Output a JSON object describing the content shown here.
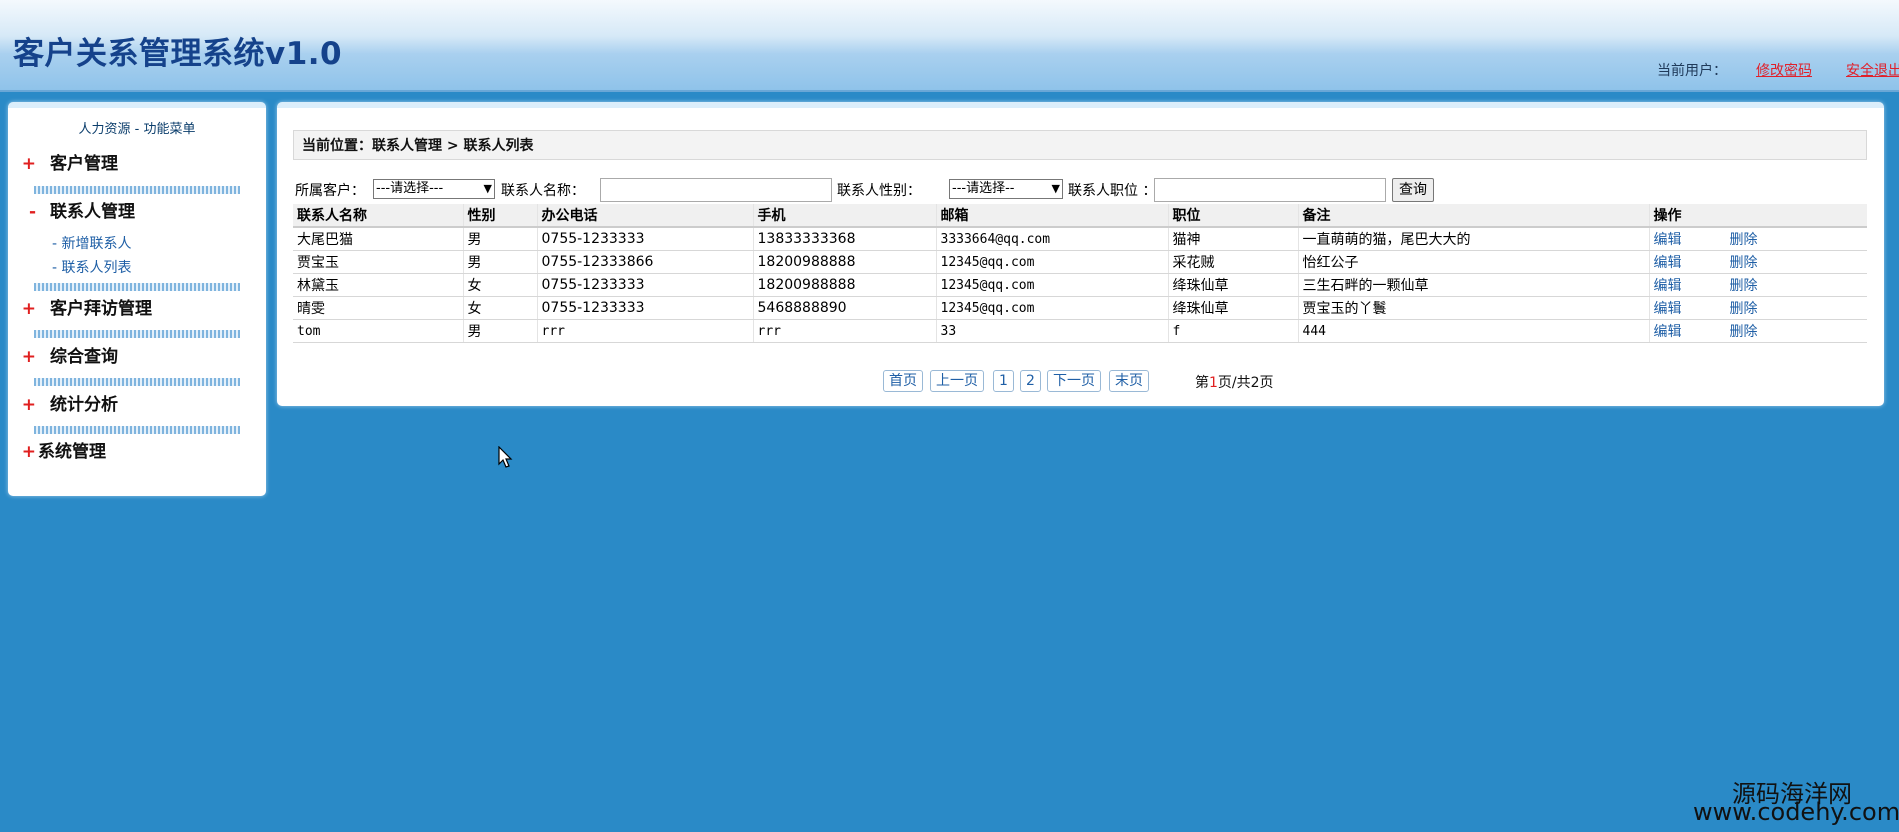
{
  "header": {
    "title": "客户关系管理系统v1.0",
    "current_user_label": "当前用户：",
    "change_password": "修改密码",
    "logout": "安全退出"
  },
  "sidebar": {
    "title": "人力资源 - 功能菜单",
    "groups": [
      {
        "sign": "+",
        "label": "客户管理"
      },
      {
        "sign": "-",
        "label": "联系人管理",
        "items": [
          "-  新增联系人",
          "- 联系人列表"
        ]
      },
      {
        "sign": "+",
        "label": "客户拜访管理"
      },
      {
        "sign": "+",
        "label": "综合查询"
      },
      {
        "sign": "+",
        "label": "统计分析"
      },
      {
        "sign": "+",
        "label": "系统管理"
      }
    ]
  },
  "main": {
    "breadcrumb": "当前位置：联系人管理 > 联系人列表",
    "filters": {
      "customer_label": "所属客户：",
      "customer_select": "---请选择---",
      "name_label": "联系人名称：",
      "gender_label": "联系人性别：",
      "gender_select": "---请选择--",
      "position_label": "联系人职位 ：",
      "query_button": "查询"
    },
    "table": {
      "headers": [
        "联系人名称",
        "性别",
        "办公电话",
        "手机",
        "邮箱",
        "职位",
        "备注",
        "操作"
      ],
      "rows": [
        [
          "大尾巴猫",
          "男",
          "0755-1233333",
          "13833333368",
          "3333664@qq.com",
          "猫神",
          "一直萌萌的猫，尾巴大大的"
        ],
        [
          "贾宝玉",
          "男",
          "0755-12333866",
          "18200988888",
          "12345@qq.com",
          "采花贼",
          "怡红公子"
        ],
        [
          "林黛玉",
          "女",
          "0755-1233333",
          "18200988888",
          "12345@qq.com",
          "绛珠仙草",
          "三生石畔的一颗仙草"
        ],
        [
          "晴雯",
          "女",
          "0755-1233333",
          "5468888890",
          "12345@qq.com",
          "绛珠仙草",
          "贾宝玉的丫鬟"
        ],
        [
          "tom",
          "男",
          "rrr",
          "rrr",
          "33",
          "f",
          "444"
        ]
      ],
      "edit_label": "编辑",
      "delete_label": "删除"
    },
    "pager": {
      "first": "首页",
      "prev": "上一页",
      "page1": "1",
      "page2": "2",
      "next": "下一页",
      "last": "末页",
      "info_prefix": "第",
      "info_current": "1",
      "info_suffix": "页/共2页"
    }
  },
  "watermark": {
    "cn": "源码海洋网",
    "url": "www.codehy.com"
  }
}
